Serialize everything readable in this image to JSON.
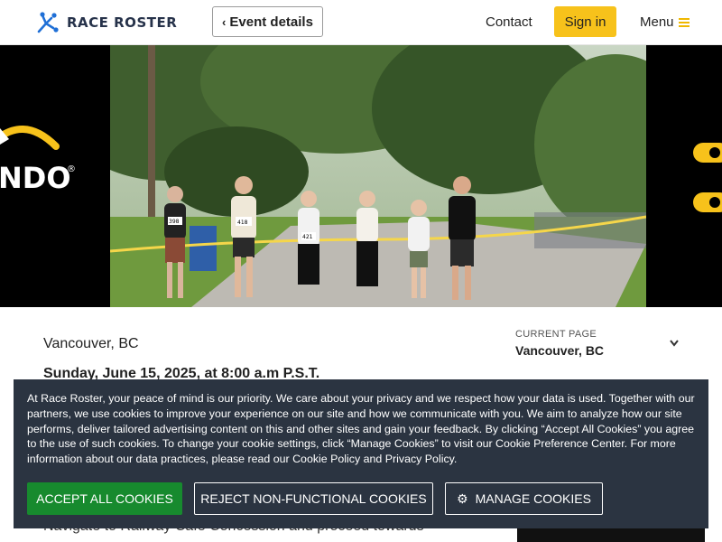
{
  "header": {
    "logo_text": "RACE ROSTER",
    "event_details_label": "Event details",
    "contact_label": "Contact",
    "signin_label": "Sign in",
    "menu_label": "Menu"
  },
  "banner": {
    "logo_fragment": "NDO",
    "registered_mark": "®",
    "bibs": [
      "398",
      "418",
      "421"
    ]
  },
  "event": {
    "location": "Vancouver, BC",
    "date_line": "Sunday, June 15, 2025, at 8:00 a.m P.S.T.",
    "navigate_text": "Navigate to Railway Cafe Concession and proceed towards"
  },
  "page_selector": {
    "label": "CURRENT PAGE",
    "value": "Vancouver, BC"
  },
  "cookie": {
    "text": "At Race Roster, your peace of mind is our priority. We care about your privacy and we respect how your data is used. Together with our partners, we use cookies to improve your experience on our site and how we communicate with you. We aim to analyze how our site performs, deliver tailored advertising content on this and other sites and gain your feedback. By clicking “Accept All Cookies” you agree to the use of such cookies. To change your cookie settings, click “Manage Cookies” to visit our Cookie Preference Center. For more information about our data practices, please read our Cookie Policy and Privacy Policy.",
    "accept_label": "ACCEPT ALL COOKIES",
    "reject_label": "REJECT NON-FUNCTIONAL COOKIES",
    "manage_label": "MANAGE COOKIES"
  },
  "colors": {
    "brand_yellow": "#f7c21b",
    "logo_blue": "#1f6fd6",
    "cookie_bg": "#2b3441",
    "accept_green": "#178a2e"
  },
  "icons": [
    "race-roster-logo-icon",
    "chevron-left-icon",
    "hamburger-icon",
    "chevron-down-icon",
    "gear-icon"
  ]
}
